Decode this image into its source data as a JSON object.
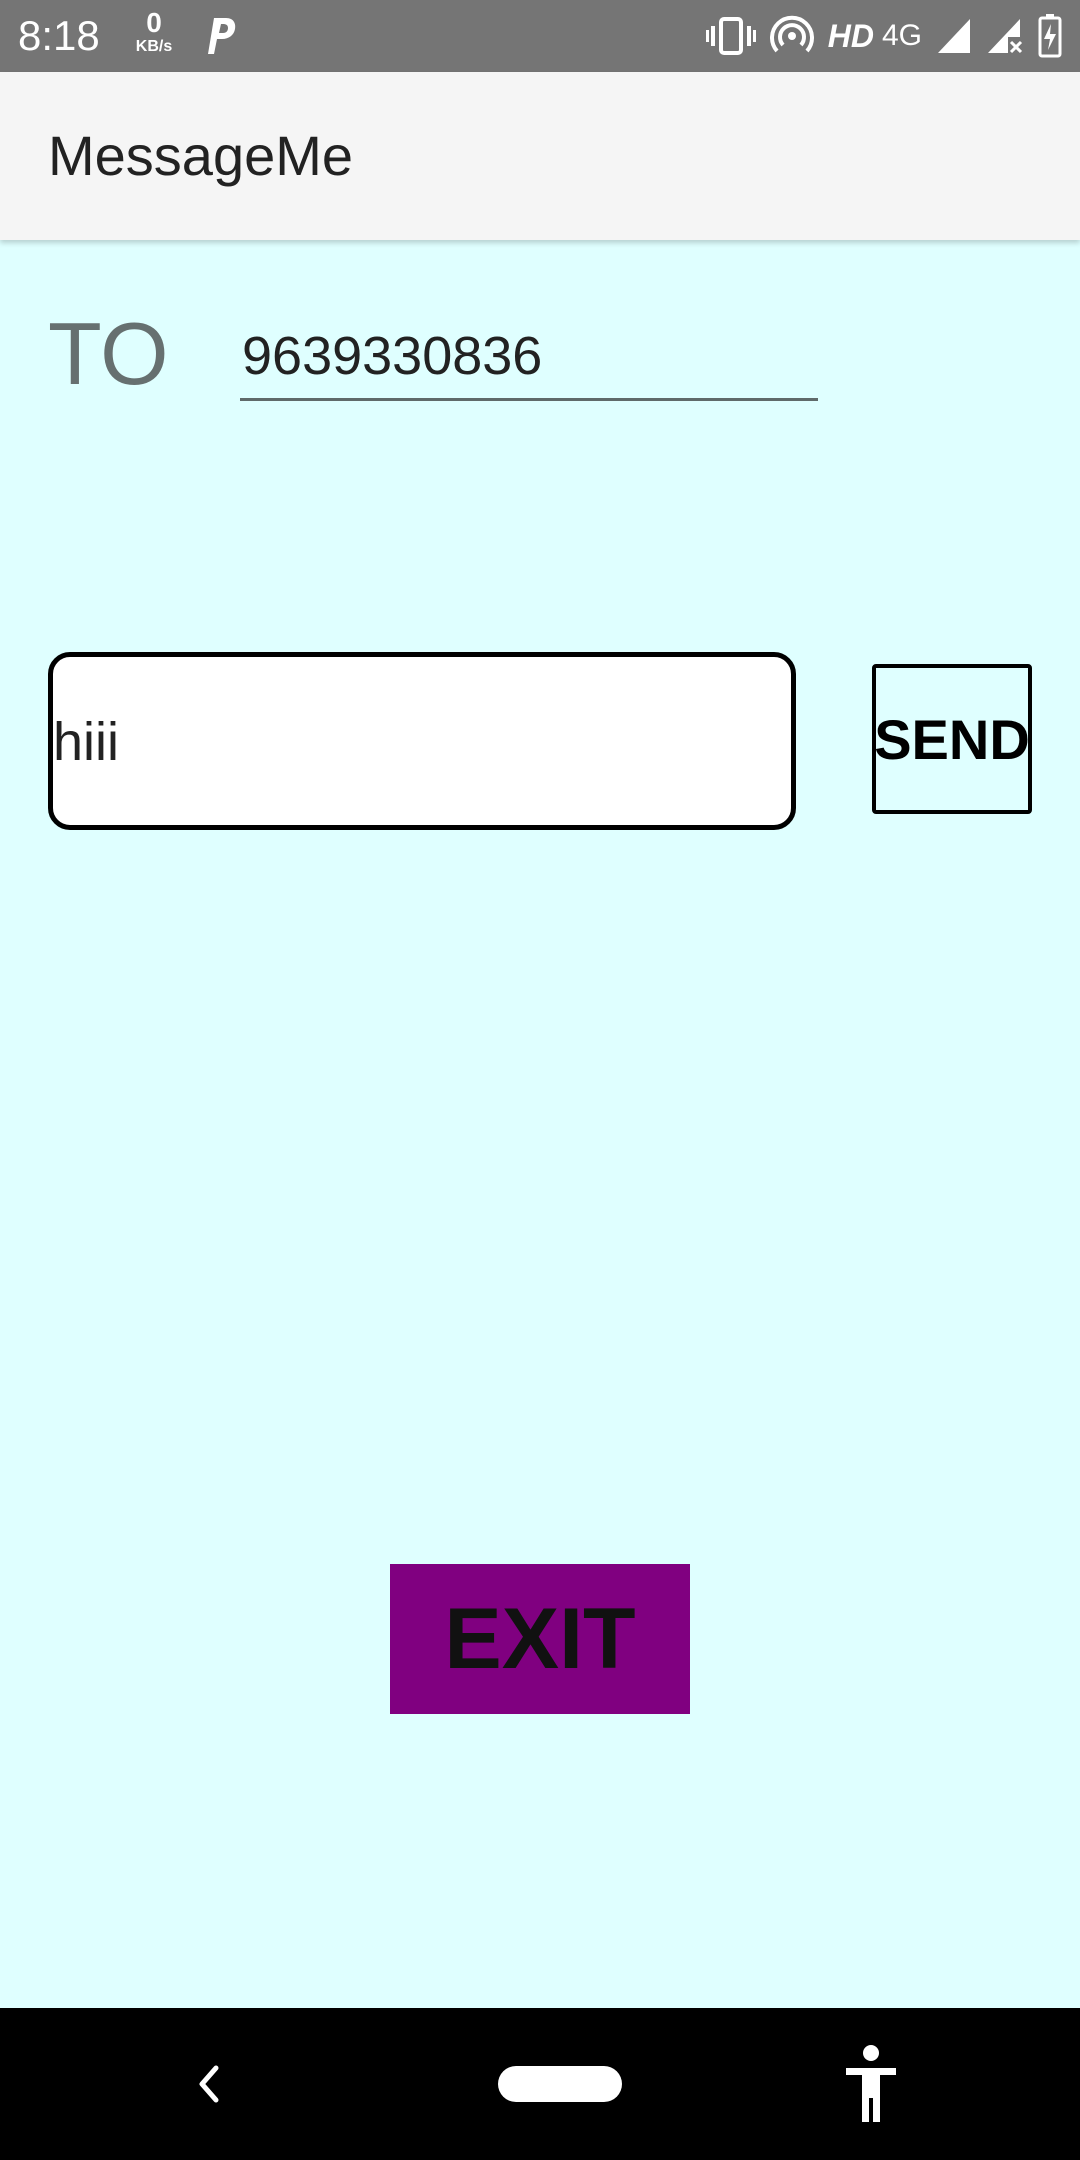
{
  "status_bar": {
    "time": "8:18",
    "net_speed_value": "0",
    "net_speed_unit": "KB/s",
    "hd": "HD",
    "network": "4G",
    "icons": [
      "p-icon",
      "vibrate-icon",
      "hotspot-icon",
      "signal-icon",
      "signal-x-icon",
      "battery-charging-icon"
    ]
  },
  "app_bar": {
    "title": "MessageMe"
  },
  "form": {
    "to_label": "TO",
    "to_value": "9639330836",
    "message_value": "hiii",
    "send_label": "SEND",
    "exit_label": "EXIT"
  },
  "nav_bar": {
    "icons": [
      "back-icon",
      "home-pill",
      "accessibility-icon"
    ]
  },
  "colors": {
    "background": "#dfffff",
    "status_bar": "#757575",
    "app_bar": "#f5f5f5",
    "exit_button": "#800080",
    "nav_bar": "#000000"
  }
}
